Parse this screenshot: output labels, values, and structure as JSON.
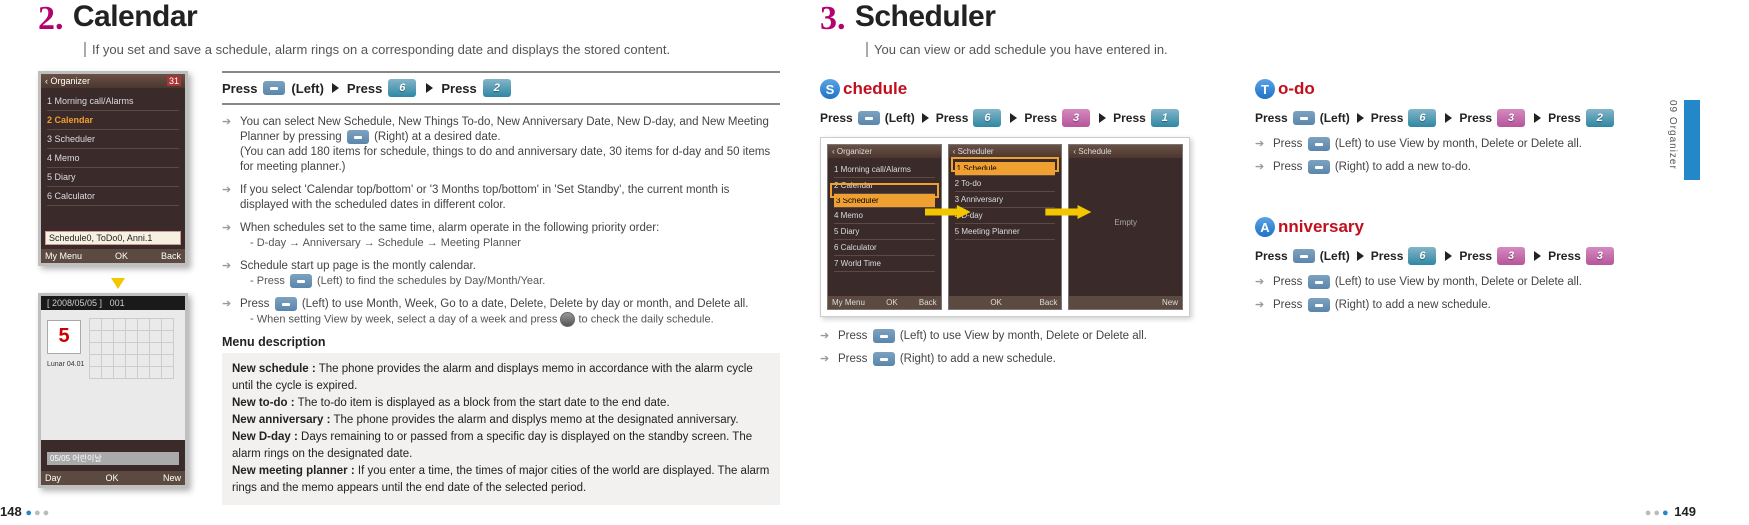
{
  "left": {
    "num": "2.",
    "title": "Calendar",
    "sub": "If you set and save a schedule, alarm rings on a corresponding date and displays the stored content.",
    "press": {
      "p": "Press",
      "left": "(Left)",
      "key6": "6",
      "key2": "2"
    },
    "screen1": {
      "title": "Organizer",
      "icon": "31",
      "items": [
        "1 Morning call/Alarms",
        "2 Calendar",
        "3 Scheduler",
        "4 Memo",
        "5 Diary",
        "6 Calculator"
      ],
      "highlight": "Schedule0, ToDo0, Anni.1",
      "soft": [
        "My Menu",
        "OK",
        "Back"
      ]
    },
    "screen2": {
      "date": "[ 2008/05/05 ]",
      "count": "001",
      "big": "5",
      "lunar": "Lunar\n04.01",
      "event": "05/05 어린이날",
      "soft": [
        "Day",
        "OK",
        "New"
      ]
    },
    "bullets": [
      {
        "t": "You can select New Schedule, New Things To-do, New Anniversary Date, New D-day, and New Meeting Planner by pressing",
        "t2": "(Right) at a desired date.",
        "t3": "(You can add 180 items for schedule, things to do and anniversary date, 30 items for d-day and 50 items for meeting planner.)"
      },
      {
        "t": "If you select 'Calendar top/bottom' or '3 Months top/bottom' in 'Set Standby', the current month is displayed with the scheduled dates in different color."
      },
      {
        "t": "When schedules set to the same time, alarm operate in the following priority order:",
        "s": "D-day → Anniversary → Schedule → Meeting Planner"
      },
      {
        "t": "Schedule start up page is the montly calendar.",
        "s": "Press",
        "s2": "(Left) to find the schedules by Day/Month/Year."
      },
      {
        "t": "Press",
        "t2": "(Left) to use Month, Week, Go to a date, Delete, Delete by day or month, and Delete all.",
        "s": "When setting View by week, select a day of a week and press",
        "s2": "to check the daily schedule."
      }
    ],
    "menuTitle": "Menu description",
    "desc": [
      {
        "k": "New schedule :",
        "v": "The phone provides the alarm and displays memo in accordance with the alarm cycle until the cycle is expired."
      },
      {
        "k": "New to-do :",
        "v": "The to-do item is displayed as a block from the start date to the end date."
      },
      {
        "k": "New anniversary :",
        "v": "The phone provides the alarm and displys memo at the designated anniversary."
      },
      {
        "k": "New D-day :",
        "v": "Days remaining to or passed from a specific day is displayed on the standby screen. The alarm rings on the designated date."
      },
      {
        "k": "New meeting planner :",
        "v": "If you enter a time, the times of major cities of the world are displayed. The alarm rings and the memo appears until the end date of the selected period."
      }
    ],
    "pageNum": "148"
  },
  "right": {
    "num": "3.",
    "title": "Scheduler",
    "sub": "You can view or add schedule you have entered in.",
    "schedule": {
      "h": "chedule",
      "c": "S",
      "press": {
        "p": "Press",
        "left": "(Left)",
        "k6": "6",
        "k3": "3",
        "k1": "1"
      },
      "s1": {
        "title": "Organizer",
        "items": [
          "1 Morning call/Alarms",
          "2 Calendar",
          "3 Scheduler",
          "4 Memo",
          "5 Diary",
          "6 Calculator",
          "7 World Time"
        ],
        "soft": [
          "My Menu",
          "OK",
          "Back"
        ]
      },
      "s2": {
        "title": "Scheduler",
        "items": [
          "1 Schedule",
          "2 To-do",
          "3 Anniversary",
          "4 D-day",
          "5 Meeting Planner"
        ],
        "soft": [
          "",
          "OK",
          "Back"
        ]
      },
      "s3": {
        "title": "Schedule",
        "empty": "Empty",
        "soft": [
          "",
          "",
          "New"
        ]
      },
      "b1": {
        "a": "Press",
        "b": "(Left) to use View by month, Delete or Delete all."
      },
      "b2": {
        "a": "Press",
        "b": "(Right) to add a new schedule."
      }
    },
    "todo": {
      "h": "o-do",
      "c": "T",
      "press": {
        "p": "Press",
        "left": "(Left)",
        "k6": "6",
        "k3": "3",
        "k2": "2"
      },
      "b1": {
        "a": "Press",
        "b": "(Left) to use View by month, Delete or Delete all."
      },
      "b2": {
        "a": "Press",
        "b": "(Right) to add a new to-do."
      }
    },
    "anni": {
      "h": "nniversary",
      "c": "A",
      "press": {
        "p": "Press",
        "left": "(Left)",
        "k6": "6",
        "k3": "3",
        "k3b": "3"
      },
      "b1": {
        "a": "Press",
        "b": "(Left) to use View by month, Delete or Delete all."
      },
      "b2": {
        "a": "Press",
        "b": "(Right) to add a new schedule."
      }
    },
    "sideLabel": "09  Organizer",
    "pageNum": "149"
  }
}
